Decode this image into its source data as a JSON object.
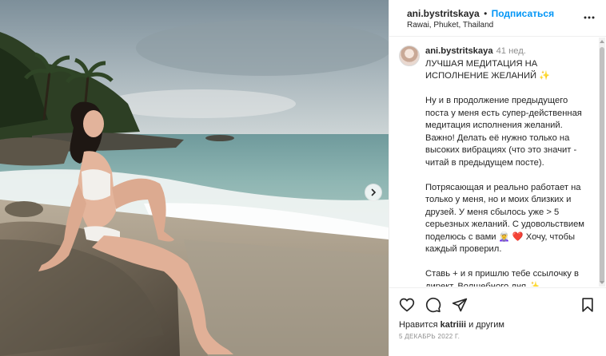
{
  "post": {
    "username": "ani.bystritskaya",
    "separator": "•",
    "follow_label": "Подписаться",
    "location": "Rawai, Phuket, Thailand"
  },
  "caption": {
    "username": "ani.bystritskaya",
    "time": "41 нед.",
    "title": "ЛУЧШАЯ МЕДИТАЦИЯ НА ИСПОЛНЕНИЕ ЖЕЛАНИЙ ✨",
    "paragraph1": "Ну и в продолжение предыдущего поста у меня есть супер-действенная медитация исполнения желаний. Важно! Делать её нужно только на высоких вибрациях (что это значит - читай в предыдущем посте).",
    "paragraph2": "Потрясающая и реально работает на только у меня, но и моих близких и друзей. У меня сбылось уже > 5 серьезных желаний. С удовольствием поделюсь с вами 🧝‍♀️ ❤️ Хочу, чтобы каждый проверил.",
    "paragraph3": "Ставь + и я пришлю тебе ссылочку в директ. Волшебного дня ✨"
  },
  "footer": {
    "likes_prefix": "Нравится",
    "likes_user": "katriiii",
    "likes_suffix": "и другим",
    "date": "5 ДЕКАБРЬ 2022 Г."
  },
  "icons": {
    "more": "more-options-icon",
    "like": "heart-icon",
    "comment": "comment-icon",
    "share": "share-icon",
    "save": "bookmark-icon",
    "next": "chevron-right-icon"
  },
  "colors": {
    "accent": "#0095f6",
    "text": "#262626",
    "muted": "#8e8e8e",
    "border": "#efefef"
  }
}
